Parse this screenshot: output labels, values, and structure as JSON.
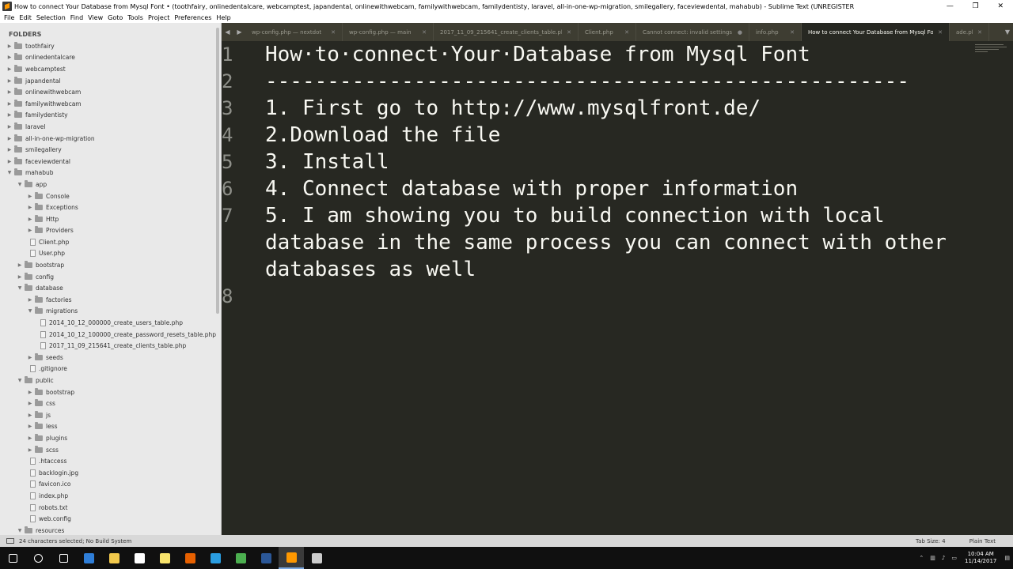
{
  "window": {
    "title": "How to connect Your Database from Mysql Font • (toothfairy, onlinedentalcare, webcamptest, japandental, onlinewithwebcam, familywithwebcam, familydentisty, laravel, all-in-one-wp-migration, smilegallery, faceviewdental, mahabub) - Sublime Text (UNREGISTER",
    "minimize": "—",
    "maximize": "❐",
    "close": "✕"
  },
  "menu": [
    "File",
    "Edit",
    "Selection",
    "Find",
    "View",
    "Goto",
    "Tools",
    "Project",
    "Preferences",
    "Help"
  ],
  "sidebar": {
    "header": "FOLDERS",
    "items": [
      {
        "label": "toothfairy",
        "type": "folder",
        "depth": 0,
        "open": false
      },
      {
        "label": "onlinedentalcare",
        "type": "folder",
        "depth": 0,
        "open": false
      },
      {
        "label": "webcamptest",
        "type": "folder",
        "depth": 0,
        "open": false
      },
      {
        "label": "japandental",
        "type": "folder",
        "depth": 0,
        "open": false
      },
      {
        "label": "onlinewithwebcam",
        "type": "folder",
        "depth": 0,
        "open": false
      },
      {
        "label": "familywithwebcam",
        "type": "folder",
        "depth": 0,
        "open": false
      },
      {
        "label": "familydentisty",
        "type": "folder",
        "depth": 0,
        "open": false
      },
      {
        "label": "laravel",
        "type": "folder",
        "depth": 0,
        "open": false
      },
      {
        "label": "all-in-one-wp-migration",
        "type": "folder",
        "depth": 0,
        "open": false
      },
      {
        "label": "smilegallery",
        "type": "folder",
        "depth": 0,
        "open": false
      },
      {
        "label": "faceviewdental",
        "type": "folder",
        "depth": 0,
        "open": false
      },
      {
        "label": "mahabub",
        "type": "folder",
        "depth": 0,
        "open": true
      },
      {
        "label": "app",
        "type": "folder",
        "depth": 1,
        "open": true
      },
      {
        "label": "Console",
        "type": "folder",
        "depth": 2,
        "open": false
      },
      {
        "label": "Exceptions",
        "type": "folder",
        "depth": 2,
        "open": false
      },
      {
        "label": "Http",
        "type": "folder",
        "depth": 2,
        "open": false
      },
      {
        "label": "Providers",
        "type": "folder",
        "depth": 2,
        "open": false
      },
      {
        "label": "Client.php",
        "type": "file",
        "depth": 2
      },
      {
        "label": "User.php",
        "type": "file",
        "depth": 2
      },
      {
        "label": "bootstrap",
        "type": "folder",
        "depth": 1,
        "open": false
      },
      {
        "label": "config",
        "type": "folder",
        "depth": 1,
        "open": false
      },
      {
        "label": "database",
        "type": "folder",
        "depth": 1,
        "open": true
      },
      {
        "label": "factories",
        "type": "folder",
        "depth": 2,
        "open": false
      },
      {
        "label": "migrations",
        "type": "folder",
        "depth": 2,
        "open": true
      },
      {
        "label": "2014_10_12_000000_create_users_table.php",
        "type": "file",
        "depth": 3
      },
      {
        "label": "2014_10_12_100000_create_password_resets_table.php",
        "type": "file",
        "depth": 3
      },
      {
        "label": "2017_11_09_215641_create_clients_table.php",
        "type": "file",
        "depth": 3
      },
      {
        "label": "seeds",
        "type": "folder",
        "depth": 2,
        "open": false
      },
      {
        "label": ".gitignore",
        "type": "file",
        "depth": 2
      },
      {
        "label": "public",
        "type": "folder",
        "depth": 1,
        "open": true
      },
      {
        "label": "bootstrap",
        "type": "folder",
        "depth": 2,
        "open": false
      },
      {
        "label": "css",
        "type": "folder",
        "depth": 2,
        "open": false
      },
      {
        "label": "js",
        "type": "folder",
        "depth": 2,
        "open": false
      },
      {
        "label": "less",
        "type": "folder",
        "depth": 2,
        "open": false
      },
      {
        "label": "plugins",
        "type": "folder",
        "depth": 2,
        "open": false
      },
      {
        "label": "scss",
        "type": "folder",
        "depth": 2,
        "open": false
      },
      {
        "label": ".htaccess",
        "type": "file",
        "depth": 2
      },
      {
        "label": "backlogin.jpg",
        "type": "file",
        "depth": 2
      },
      {
        "label": "favicon.ico",
        "type": "file",
        "depth": 2
      },
      {
        "label": "index.php",
        "type": "file",
        "depth": 2
      },
      {
        "label": "robots.txt",
        "type": "file",
        "depth": 2
      },
      {
        "label": "web.config",
        "type": "file",
        "depth": 2
      },
      {
        "label": "resources",
        "type": "folder",
        "depth": 1,
        "open": true
      }
    ]
  },
  "tabs": [
    {
      "label": "wp-config.php — nextdot",
      "active": false
    },
    {
      "label": "wp-config.php — main",
      "active": false
    },
    {
      "label": "2017_11_09_215641_create_clients_table.php",
      "active": false
    },
    {
      "label": "Client.php",
      "active": false
    },
    {
      "label": "Cannot connect: invalid settings",
      "active": false,
      "dirty": true
    },
    {
      "label": "info.php",
      "active": false
    },
    {
      "label": "How to connect Your Database from Mysql Font",
      "active": true
    },
    {
      "label": "ade.php",
      "active": false
    }
  ],
  "editor": {
    "lines": [
      {
        "num": "1",
        "text": "How·to·connect·Your·Database from Mysql Font"
      },
      {
        "num": "2",
        "text": "----------------------------------------------------"
      },
      {
        "num": "3",
        "text": "1. First go to http://www.mysqlfront.de/"
      },
      {
        "num": "4",
        "text": "2.Download the file"
      },
      {
        "num": "5",
        "text": "3. Install"
      },
      {
        "num": "6",
        "text": "4. Connect database with proper information"
      },
      {
        "num": "7",
        "text": "5. I am showing you to build connection with local"
      },
      {
        "num": "",
        "text": "database in the same process you can connect with other"
      },
      {
        "num": "",
        "text": "databases as well"
      },
      {
        "num": "8",
        "text": ""
      }
    ]
  },
  "status": {
    "left": "24 characters selected; No Build System",
    "tab_size": "Tab Size: 4",
    "syntax": "Plain Text"
  },
  "taskbar": {
    "icons": [
      {
        "name": "windows-start-icon",
        "color": "#ffffff"
      },
      {
        "name": "search-icon",
        "color": "#ffffff"
      },
      {
        "name": "task-view-icon",
        "color": "#ffffff"
      },
      {
        "name": "edge-icon",
        "color": "#2f7ed8"
      },
      {
        "name": "file-explorer-icon",
        "color": "#f2c94c"
      },
      {
        "name": "store-icon",
        "color": "#ffffff"
      },
      {
        "name": "sticky-notes-icon",
        "color": "#f7e26b"
      },
      {
        "name": "firefox-icon",
        "color": "#e66000"
      },
      {
        "name": "skype-icon",
        "color": "#2a9de0"
      },
      {
        "name": "chrome-icon",
        "color": "#4caf50"
      },
      {
        "name": "word-icon",
        "color": "#2b5797"
      },
      {
        "name": "sublime-text-icon",
        "color": "#ff9800"
      },
      {
        "name": "misc-app-icon",
        "color": "#cccccc"
      }
    ],
    "active_index": 11,
    "time": "10:04 AM",
    "date": "11/14/2017"
  }
}
